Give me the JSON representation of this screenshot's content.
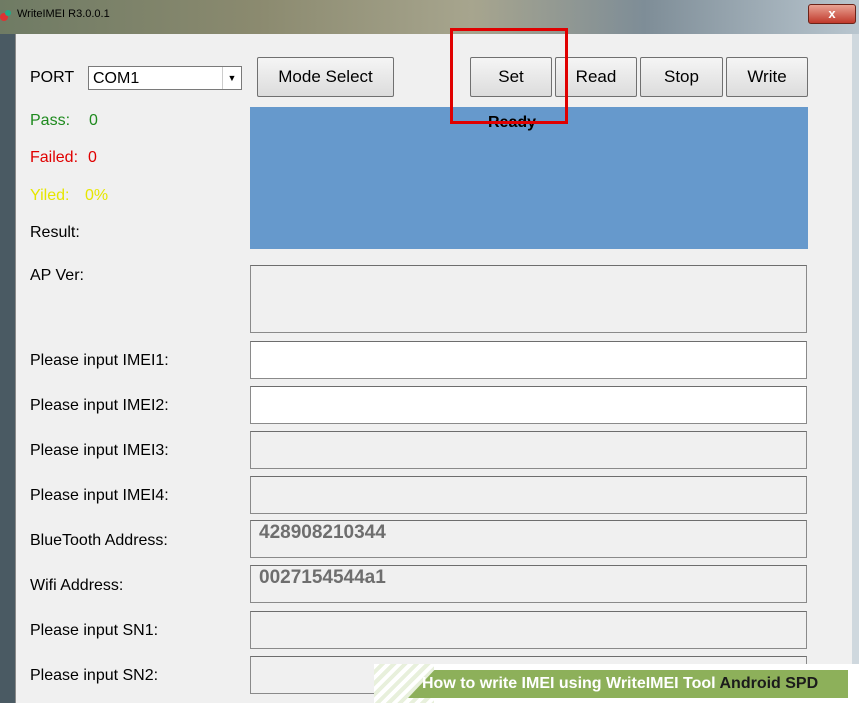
{
  "window": {
    "title": "WriteIMEI R3.0.0.1",
    "close_label": "x"
  },
  "port": {
    "label": "PORT",
    "value": "COM1"
  },
  "buttons": {
    "mode_select": "Mode Select",
    "set": "Set",
    "read": "Read",
    "stop": "Stop",
    "write": "Write"
  },
  "stats": {
    "pass_label": "Pass:",
    "pass_value": "0",
    "failed_label": "Failed:",
    "failed_value": "0",
    "yield_label": "Yiled:",
    "yield_value": "0%",
    "result_label": "Result:",
    "pass_color": "#1e8a1e",
    "failed_color": "#e00000",
    "yield_color": "#e6e600"
  },
  "status": {
    "text": "Ready",
    "panel_color": "#6699cc"
  },
  "fields": {
    "ap_ver": {
      "label": "AP Ver:",
      "value": ""
    },
    "imei1": {
      "label": "Please input IMEI1:",
      "value": ""
    },
    "imei2": {
      "label": "Please input IMEI2:",
      "value": ""
    },
    "imei3": {
      "label": "Please input IMEI3:",
      "value": ""
    },
    "imei4": {
      "label": "Please input IMEI4:",
      "value": ""
    },
    "bluetooth": {
      "label": "BlueTooth Address:",
      "value": "428908210344"
    },
    "wifi": {
      "label": "Wifi Address:",
      "value": "0027154544a1"
    },
    "sn1": {
      "label": "Please input SN1:",
      "value": ""
    },
    "sn2": {
      "label": "Please input SN2:",
      "value": ""
    }
  },
  "banner": {
    "text": "How to write IMEI using WriteIMEI Tool",
    "emphasis": "Android SPD"
  },
  "icons": {
    "app": "app-icon",
    "dropdown": "chevron-down-icon"
  }
}
